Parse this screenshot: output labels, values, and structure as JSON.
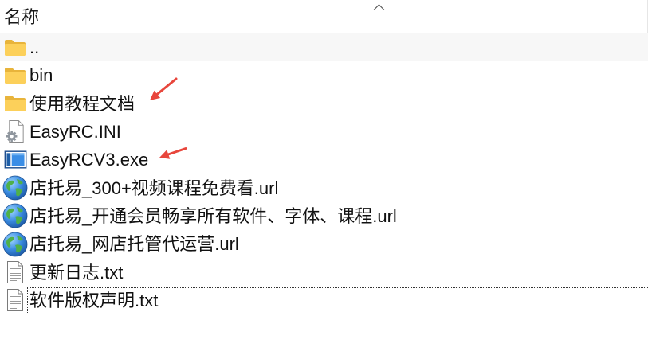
{
  "header": {
    "name_label": "名称",
    "sort_icon": "chevron-up-icon"
  },
  "files": [
    {
      "name": "..",
      "icon": "folder-icon",
      "hovered": true
    },
    {
      "name": "bin",
      "icon": "folder-icon"
    },
    {
      "name": "使用教程文档",
      "icon": "folder-icon"
    },
    {
      "name": "EasyRC.INI",
      "icon": "settings-file-icon"
    },
    {
      "name": "EasyRCV3.exe",
      "icon": "exe-file-icon"
    },
    {
      "name": "店托易_300+视频课程免费看.url",
      "icon": "globe-icon"
    },
    {
      "name": "店托易_开通会员畅享所有软件、字体、课程.url",
      "icon": "globe-icon"
    },
    {
      "name": "店托易_网店托管代运营.url",
      "icon": "globe-icon"
    },
    {
      "name": "更新日志.txt",
      "icon": "text-file-icon"
    },
    {
      "name": "软件版权声明.txt",
      "icon": "text-file-icon",
      "focused": true
    }
  ],
  "colors": {
    "annotation_arrow": "#e8463c",
    "folder": "#fcd05a",
    "folder_back": "#e8b43b",
    "globe": "#2f7fd4",
    "exe": "#1f5fa8"
  }
}
